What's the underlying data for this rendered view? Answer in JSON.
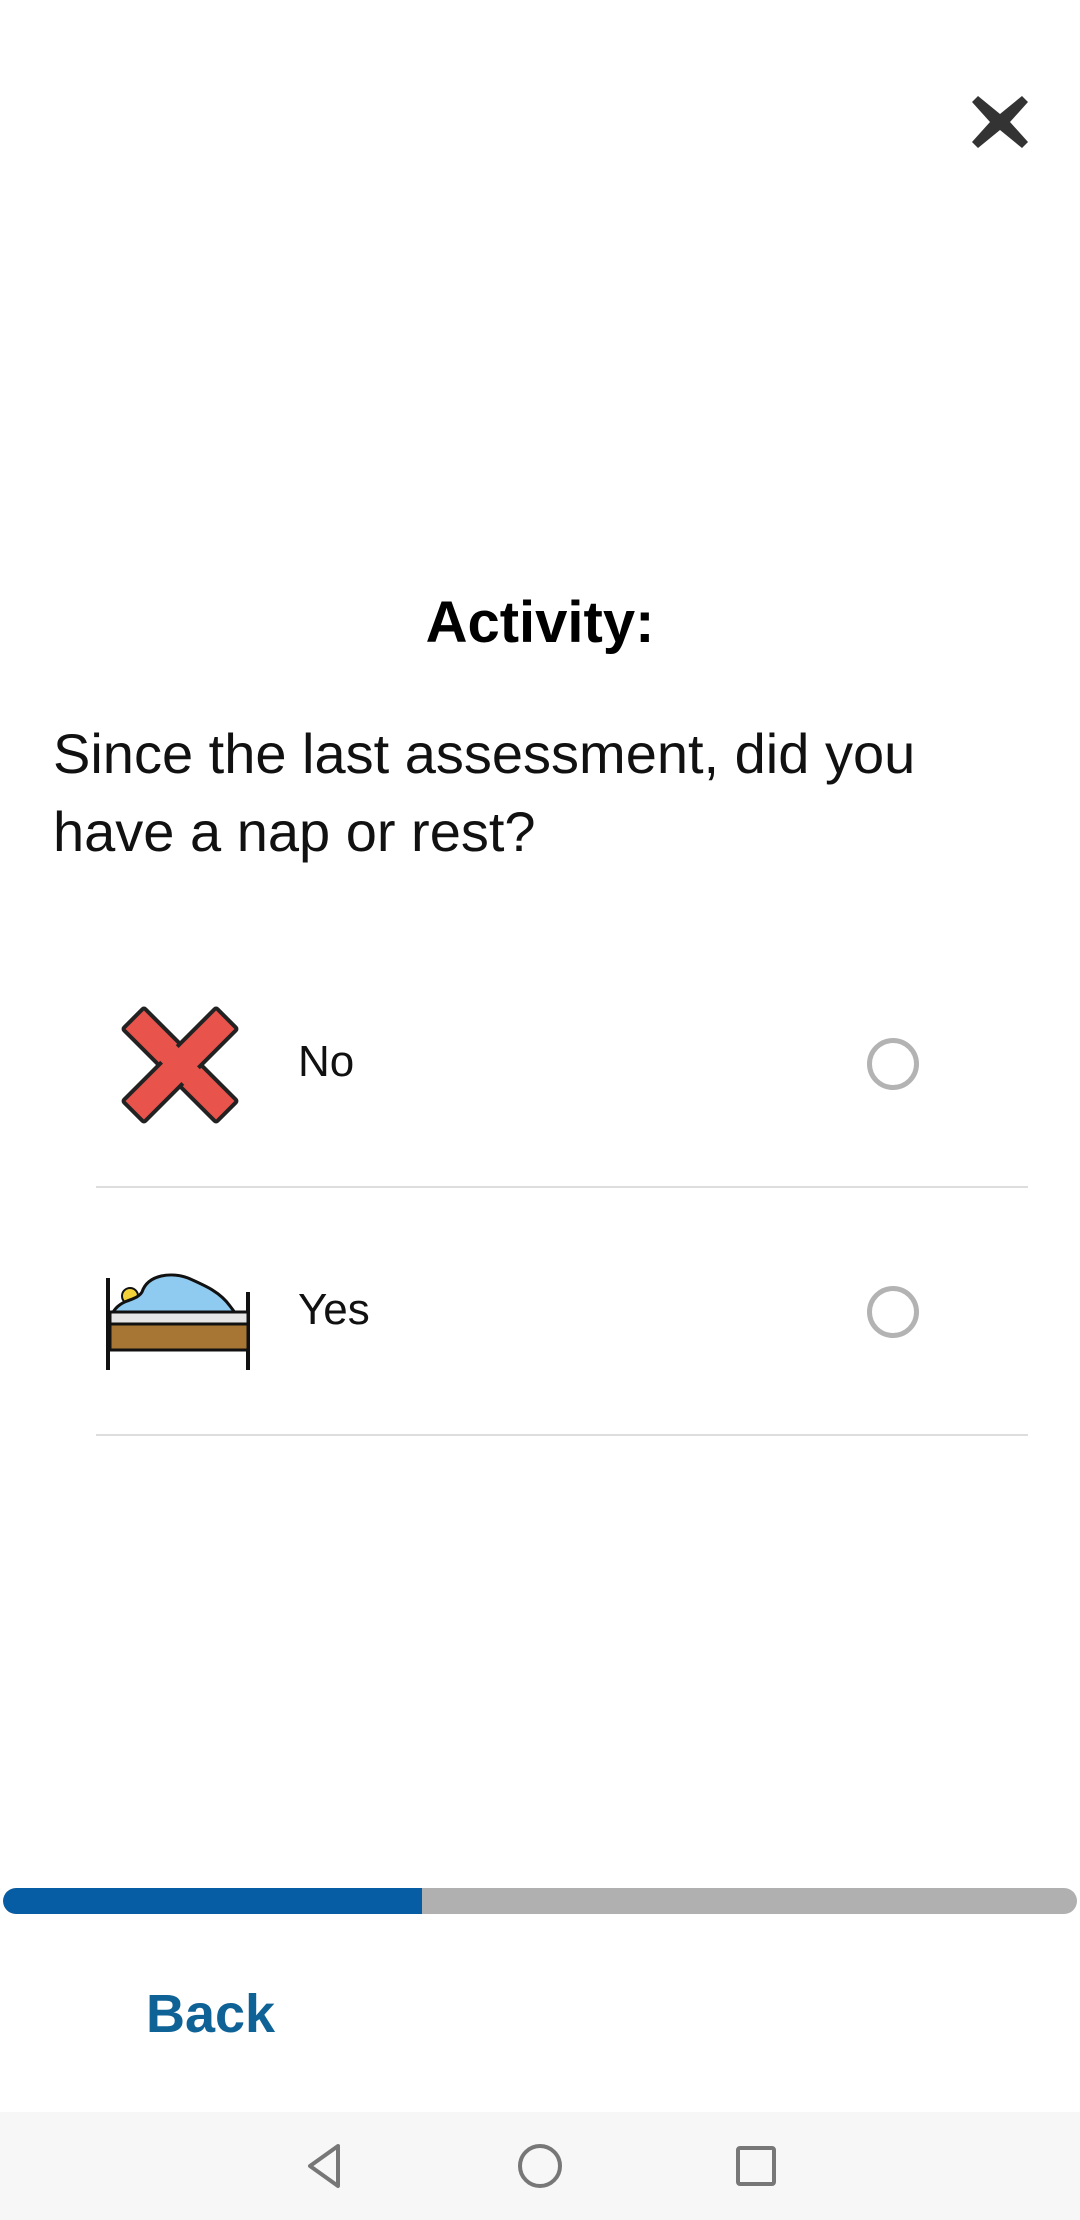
{
  "header": {
    "close_icon": "close-icon"
  },
  "content": {
    "title": "Activity:",
    "question": "Since the last assessment, did you have a nap or rest?"
  },
  "options": [
    {
      "label": "No",
      "icon": "red-x-icon",
      "selected": false
    },
    {
      "label": "Yes",
      "icon": "bed-icon",
      "selected": false
    }
  ],
  "progress": {
    "fraction": 0.39,
    "fill_color": "#075da4",
    "track_color": "#b0b0b0"
  },
  "footer": {
    "back_label": "Back"
  },
  "colors": {
    "accent": "#0f6296",
    "radio_border": "#b3b3b3",
    "divider": "#dddddd"
  },
  "navbar": {
    "back_icon": "nav-back-icon",
    "home_icon": "nav-home-icon",
    "recents_icon": "nav-recents-icon"
  }
}
